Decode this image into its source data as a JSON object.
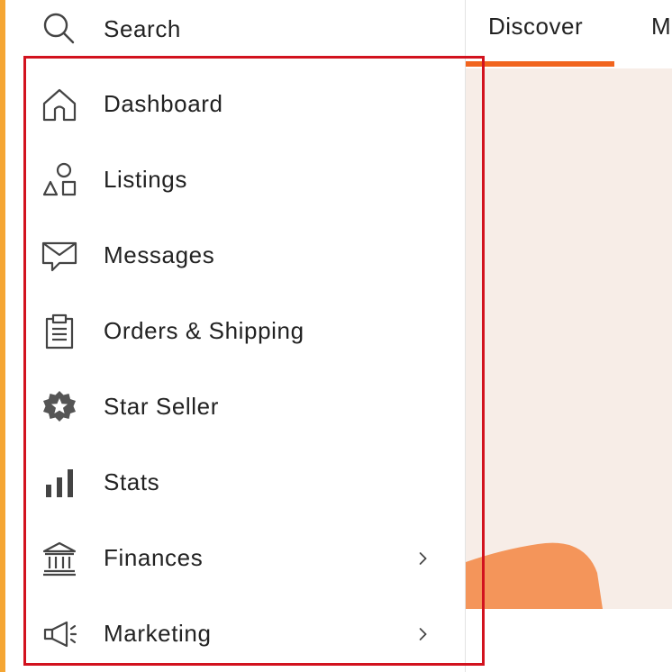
{
  "colors": {
    "accent_strip": "#f5a633",
    "tab_underline": "#f1641e",
    "highlight_box": "#d2121e",
    "hero_background": "#f7ede7",
    "hero_shape": "#f4955a"
  },
  "search": {
    "label": "Search",
    "icon": "search-icon"
  },
  "sidebar": {
    "items": [
      {
        "label": "Dashboard",
        "icon": "home-icon",
        "has_chevron": false
      },
      {
        "label": "Listings",
        "icon": "shapes-icon",
        "has_chevron": false
      },
      {
        "label": "Messages",
        "icon": "envelope-icon",
        "has_chevron": false
      },
      {
        "label": "Orders & Shipping",
        "icon": "clipboard-icon",
        "has_chevron": false
      },
      {
        "label": "Star Seller",
        "icon": "star-badge-icon",
        "has_chevron": false
      },
      {
        "label": "Stats",
        "icon": "bar-chart-icon",
        "has_chevron": false
      },
      {
        "label": "Finances",
        "icon": "bank-icon",
        "has_chevron": true
      },
      {
        "label": "Marketing",
        "icon": "megaphone-icon",
        "has_chevron": true
      }
    ]
  },
  "content": {
    "tabs": [
      {
        "label": "Discover",
        "active": true
      },
      {
        "label": "M",
        "active": false
      }
    ]
  }
}
